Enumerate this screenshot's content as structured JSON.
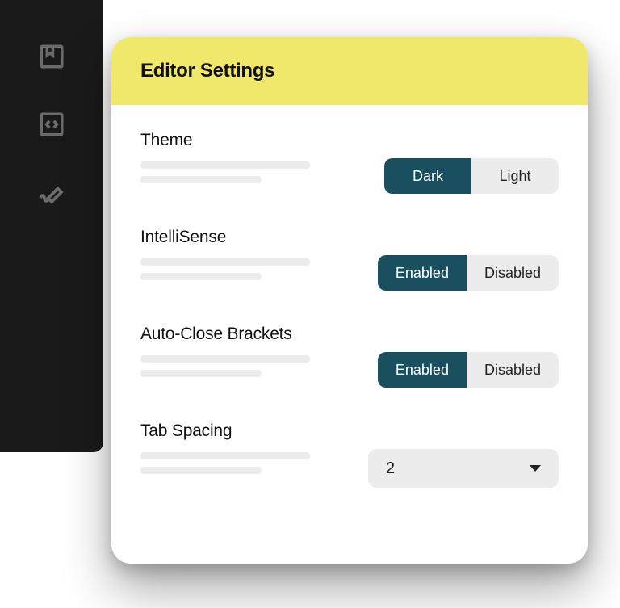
{
  "panel": {
    "title": "Editor Settings"
  },
  "settings": {
    "theme": {
      "label": "Theme",
      "option_active": "Dark",
      "option_inactive": "Light"
    },
    "intellisense": {
      "label": "IntelliSense",
      "option_active": "Enabled",
      "option_inactive": "Disabled"
    },
    "autoclose": {
      "label": "Auto-Close Brackets",
      "option_active": "Enabled",
      "option_inactive": "Disabled"
    },
    "tabspacing": {
      "label": "Tab Spacing",
      "value": "2"
    }
  }
}
